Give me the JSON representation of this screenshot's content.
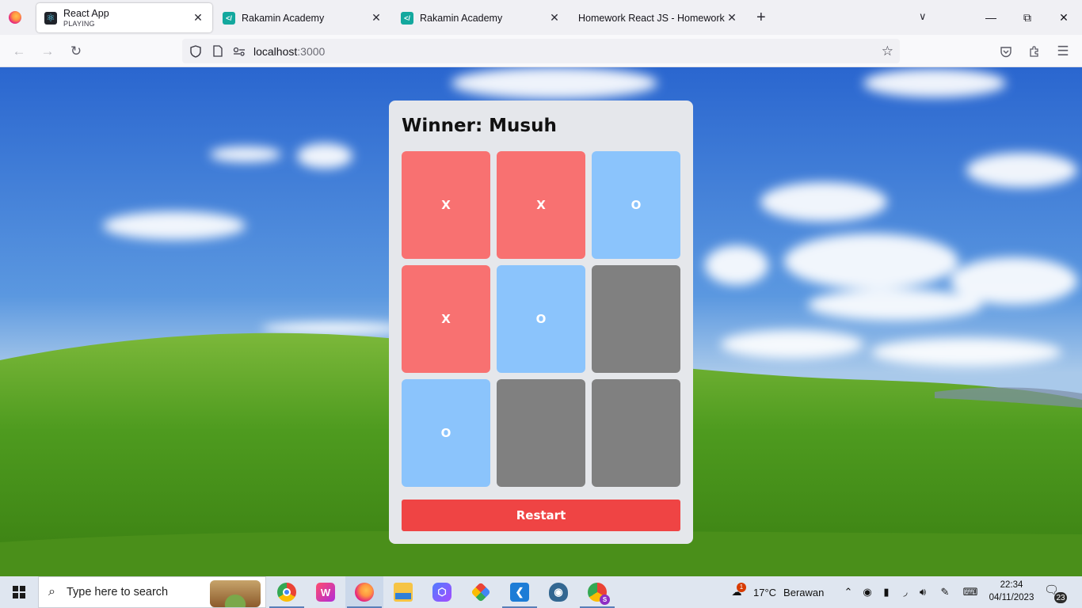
{
  "browser": {
    "tabs": [
      {
        "title": "React App",
        "subtitle": "PLAYING",
        "favicon": "react-icon",
        "active": true
      },
      {
        "title": "Rakamin Academy",
        "favicon": "rakamin-icon",
        "active": false
      },
      {
        "title": "Rakamin Academy",
        "favicon": "rakamin-icon",
        "active": false
      },
      {
        "title": "Homework React JS - Homework Re",
        "favicon": "none",
        "active": false
      }
    ],
    "new_tab_glyph": "+",
    "close_glyph": "✕",
    "url_host": "localhost",
    "url_port": ":3000"
  },
  "game": {
    "status": "Winner: Musuh",
    "board": [
      {
        "value": "X",
        "color": "#f87171"
      },
      {
        "value": "X",
        "color": "#f87171"
      },
      {
        "value": "O",
        "color": "#8bc4fc"
      },
      {
        "value": "X",
        "color": "#f87171"
      },
      {
        "value": "O",
        "color": "#8bc4fc"
      },
      {
        "value": "",
        "color": "#808080"
      },
      {
        "value": "O",
        "color": "#8bc4fc"
      },
      {
        "value": "",
        "color": "#808080"
      },
      {
        "value": "",
        "color": "#808080"
      }
    ],
    "restart_label": "Restart",
    "restart_color": "#ef4444"
  },
  "taskbar": {
    "search_placeholder": "Type here to search",
    "apps": [
      "chrome-icon",
      "wps-office-icon",
      "firefox-icon",
      "file-explorer-icon",
      "app-icon",
      "git-icon",
      "vscode-icon",
      "postgresql-icon",
      "chrome-profile-icon"
    ],
    "weather_temp": "17°C",
    "weather_desc": "Berawan",
    "weather_alert": "1",
    "time": "22:34",
    "date": "04/11/2023",
    "notifications": "23"
  }
}
